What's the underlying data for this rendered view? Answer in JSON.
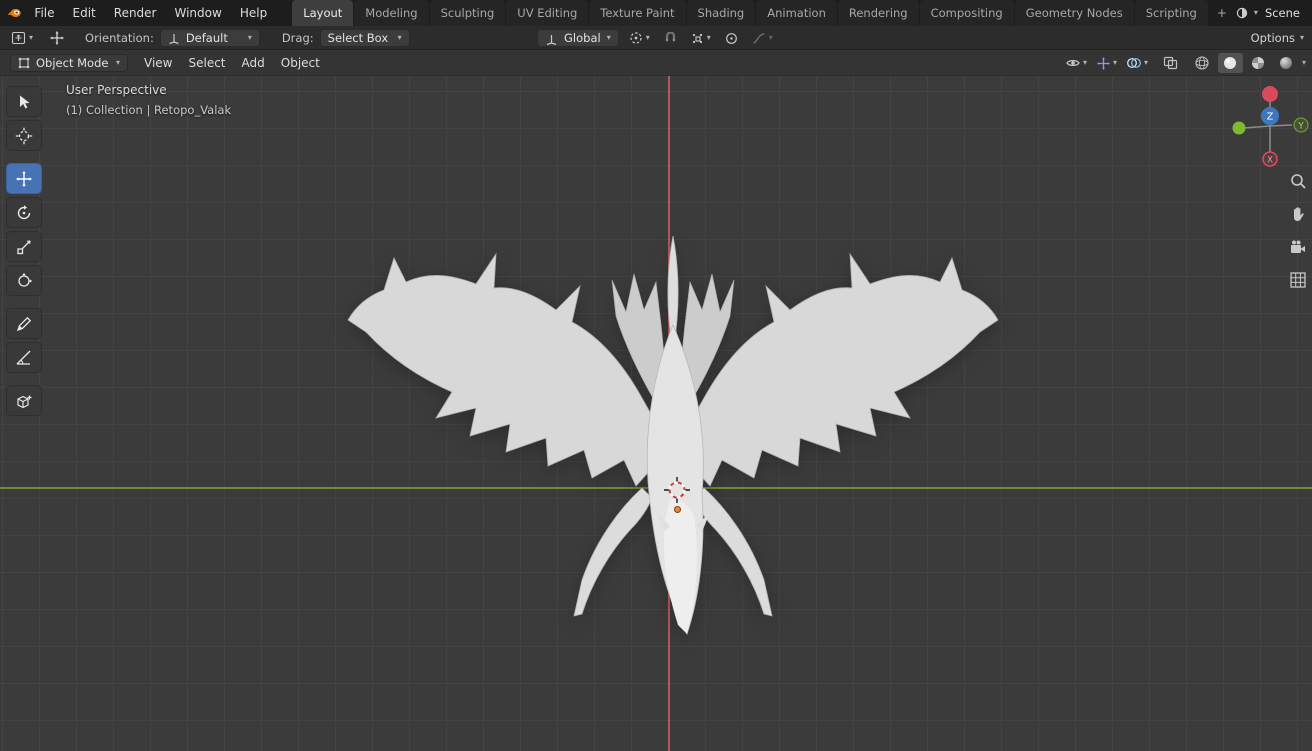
{
  "icons": {
    "chevron_down": "▾"
  },
  "topbar": {
    "menus": [
      "File",
      "Edit",
      "Render",
      "Window",
      "Help"
    ],
    "tabs": [
      "Layout",
      "Modeling",
      "Sculpting",
      "UV Editing",
      "Texture Paint",
      "Shading",
      "Animation",
      "Rendering",
      "Compositing",
      "Geometry Nodes",
      "Scripting"
    ],
    "active_tab": "Layout",
    "add_tab_label": "+",
    "scene": {
      "label": "Scene"
    }
  },
  "tool_settings": {
    "orientation_label": "Orientation:",
    "orientation_value": "Default",
    "drag_label": "Drag:",
    "drag_value": "Select Box",
    "transform_orientation_value": "Global",
    "options_label": "Options"
  },
  "viewport_header": {
    "mode_value": "Object Mode",
    "menus": [
      "View",
      "Select",
      "Add",
      "Object"
    ]
  },
  "viewport_overlay": {
    "view_label": "User Perspective",
    "breadcrumb": "(1) Collection | Retopo_Valak"
  },
  "nav_gizmo": {
    "x_label": "X",
    "y_label": "Y",
    "z_label": "Z"
  },
  "left_toolbar": {
    "tools": [
      "select-box",
      "cursor",
      "move",
      "rotate",
      "scale",
      "transform",
      "annotate",
      "measure",
      "add-cube"
    ],
    "active_tool": "move"
  },
  "shading_modes": [
    "wireframe",
    "solid",
    "material-preview",
    "rendered"
  ],
  "active_shading_mode": "solid",
  "colors": {
    "accent_blue": "#4772b3",
    "axis_red": "#c95a62",
    "axis_green": "#72a032",
    "axis_z_blue": "#3f77bf",
    "viewport_bg": "#3b3b3b",
    "grid_line": "#434343",
    "topbar_bg": "#1d1d1d",
    "origin_orange": "#e8873b"
  }
}
